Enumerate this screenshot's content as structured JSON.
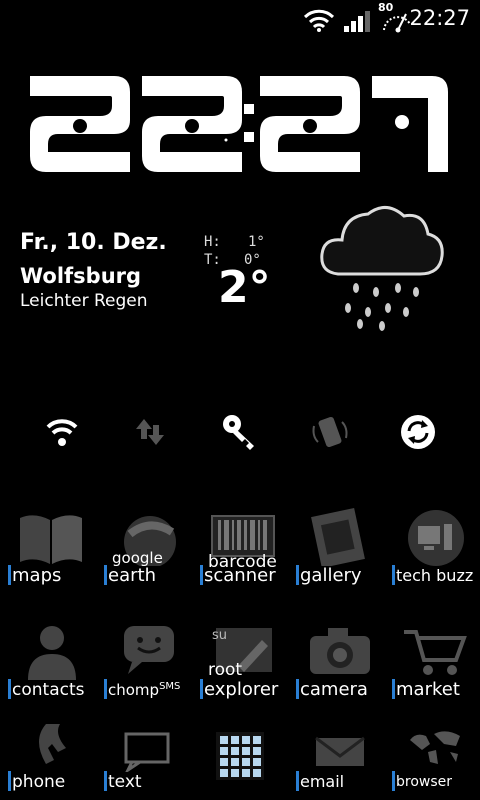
{
  "status_bar": {
    "time": "22:27",
    "battery_level": "80",
    "icons": [
      "wifi-icon",
      "signal-icon",
      "battery-gauge-icon"
    ]
  },
  "clock": {
    "time": "22:27"
  },
  "weather": {
    "date": "Fr., 10. Dez.",
    "city": "Wolfsburg",
    "condition": "Leichter Regen",
    "high_label": "H:",
    "high": "1°",
    "low_label": "T:",
    "low": "0°",
    "current": "2°",
    "icon": "rain-cloud-icon"
  },
  "toggles": [
    {
      "name": "wifi-toggle",
      "icon": "wifi-icon",
      "active": true
    },
    {
      "name": "data-toggle",
      "icon": "data-arrows-icon",
      "active": false
    },
    {
      "name": "key-toggle",
      "icon": "key-icon",
      "active": true
    },
    {
      "name": "rotate-toggle",
      "icon": "rotate-phone-icon",
      "active": false
    },
    {
      "name": "sync-toggle",
      "icon": "sync-icon",
      "active": true
    }
  ],
  "apps": {
    "maps": {
      "label": "maps"
    },
    "earth": {
      "top": "google",
      "label": "earth"
    },
    "barcode": {
      "top": "barcode",
      "label": "scanner"
    },
    "gallery": {
      "label": "gallery"
    },
    "techbuzz": {
      "label": "tech buzz"
    },
    "contacts": {
      "label": "contacts"
    },
    "chomp": {
      "label": "chomp",
      "sup": "SMS"
    },
    "root": {
      "top": "root",
      "label": "explorer",
      "icon_text": "su"
    },
    "camera": {
      "label": "camera"
    },
    "market": {
      "label": "market"
    },
    "phone": {
      "label": "phone"
    },
    "text": {
      "label": "text"
    },
    "email": {
      "label": "email"
    },
    "browser": {
      "label": "browser"
    }
  },
  "colors": {
    "accent": "#2a7fd4",
    "background": "#000000"
  }
}
